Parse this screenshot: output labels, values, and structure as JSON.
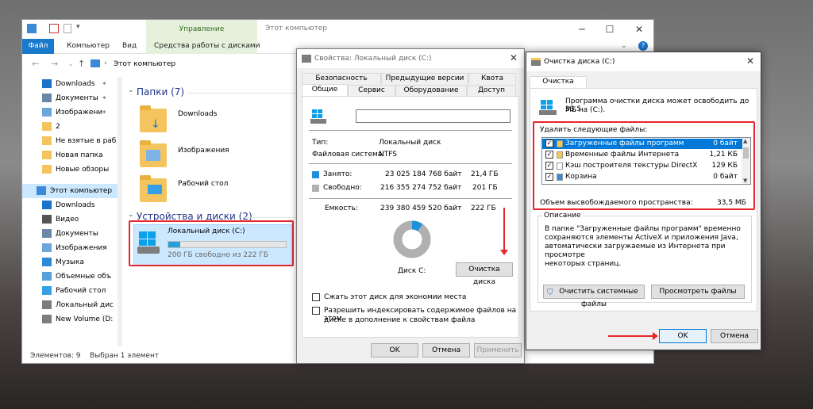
{
  "explorer": {
    "title": "Этот компьютер",
    "context_tab": "Управление",
    "menu": [
      "Файл",
      "Компьютер",
      "Вид",
      "Средства работы с дисками"
    ],
    "address": "Этот компьютер",
    "sidebar": [
      {
        "label": "Downloads",
        "pinned": true,
        "icon": "download-icon"
      },
      {
        "label": "Документы",
        "pinned": true,
        "icon": "documents-icon"
      },
      {
        "label": "Изображени",
        "pinned": true,
        "icon": "pictures-icon"
      },
      {
        "label": "2",
        "pinned": false,
        "icon": "folder-icon"
      },
      {
        "label": "Не взятые в раб",
        "pinned": false,
        "icon": "folder-icon"
      },
      {
        "label": "Новая папка",
        "pinned": false,
        "icon": "folder-icon"
      },
      {
        "label": "Новые обзоры",
        "pinned": false,
        "icon": "folder-icon"
      },
      {
        "label": "Этот компьютер",
        "pinned": false,
        "icon": "computer-icon"
      },
      {
        "label": "Downloads",
        "pinned": false,
        "icon": "download-icon"
      },
      {
        "label": "Видео",
        "pinned": false,
        "icon": "video-icon"
      },
      {
        "label": "Документы",
        "pinned": false,
        "icon": "documents-icon"
      },
      {
        "label": "Изображения",
        "pinned": false,
        "icon": "pictures-icon"
      },
      {
        "label": "Музыка",
        "pinned": false,
        "icon": "music-icon"
      },
      {
        "label": "Объемные объ",
        "pinned": false,
        "icon": "3d-objects-icon"
      },
      {
        "label": "Рабочий стол",
        "pinned": false,
        "icon": "desktop-icon"
      },
      {
        "label": "Локальный дис",
        "pinned": false,
        "icon": "drive-icon"
      },
      {
        "label": "New Volume (D:",
        "pinned": false,
        "icon": "drive-icon"
      }
    ],
    "folders_group": "Папки (7)",
    "folders": [
      "Downloads",
      "Изображения",
      "Рабочий стол"
    ],
    "devices_group": "Устройства и диски (2)",
    "drive": {
      "name": "Локальный диск (C:)",
      "free_text": "200 ГБ свободно из 222 ГБ",
      "used_fraction": 0.1
    },
    "status_items": "Элементов: 9",
    "status_selected": "Выбран 1 элемент"
  },
  "props": {
    "title": "Свойства: Локальный диск (C:)",
    "tabs_row1": [
      "Безопасность",
      "Предыдущие версии",
      "Квота"
    ],
    "tabs_row2": [
      "Общие",
      "Сервис",
      "Оборудование",
      "Доступ"
    ],
    "type_label": "Тип:",
    "type_value": "Локальный диск",
    "fs_label": "Файловая система:",
    "fs_value": "NTFS",
    "used_label": "Занято:",
    "used_bytes": "23 025 184 768 байт",
    "used_gb": "21,4 ГБ",
    "free_label": "Свободно:",
    "free_bytes": "216 355 274 752 байт",
    "free_gb": "201 ГБ",
    "cap_label": "Емкость:",
    "cap_bytes": "239 380 459 520 байт",
    "cap_gb": "222 ГБ",
    "used_fraction": 0.096,
    "disk_label": "Диск C:",
    "cleanup_button": "Очистка диска",
    "compress_label": "Сжать этот диск для экономии места",
    "index_label_1": "Разрешить индексировать содержимое файлов на этом",
    "index_label_2": "диске в дополнение к свойствам файла",
    "ok": "OK",
    "cancel": "Отмена",
    "apply": "Применить",
    "colors": {
      "used": "#1e90d8",
      "free": "#b0b0b0"
    }
  },
  "cleanup": {
    "title": "Очистка диска  (C:)",
    "tab": "Очистка диска",
    "intro_1": "Программа очистки диска может освободить до 33,5",
    "intro_2": "МБ на  (C:).",
    "delete_label": "Удалить следующие файлы:",
    "items": [
      {
        "name": "Загруженные файлы программ",
        "size": "0 байт",
        "checked": true,
        "selected": true
      },
      {
        "name": "Временные файлы Интернета",
        "size": "1,21 КБ",
        "checked": true,
        "selected": false
      },
      {
        "name": "Кэш построителя текстуры DirectX",
        "size": "129 КБ",
        "checked": true,
        "selected": false
      },
      {
        "name": "Корзина",
        "size": "0 байт",
        "checked": true,
        "selected": false
      }
    ],
    "total_label": "Объем высвобождаемого пространства:",
    "total_value": "33,5 МБ",
    "desc_title": "Описание",
    "desc_lines": [
      "В папке \"Загруженные файлы программ\" временно",
      "сохраняются элементы ActiveX и приложения Java,",
      "автоматически загружаемые из Интернета при просмотре",
      "некоторых страниц."
    ],
    "sys_button": "Очистить системные файлы",
    "view_button": "Просмотреть файлы",
    "ok": "OK",
    "cancel": "Отмена"
  }
}
